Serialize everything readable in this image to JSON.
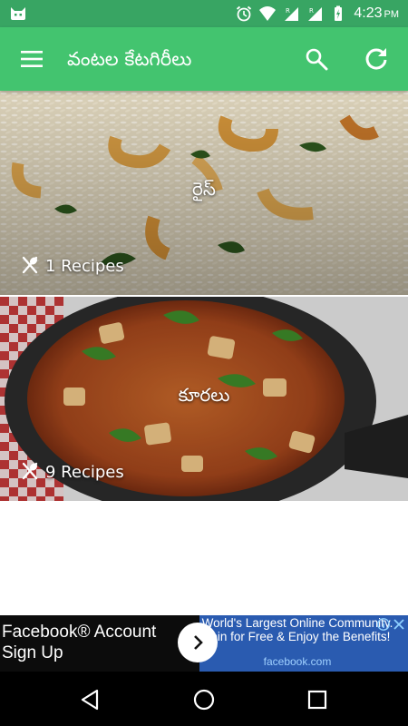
{
  "status_bar": {
    "time": "4:23",
    "ampm": "PM",
    "icons": [
      "android-cat-icon",
      "alarm-icon",
      "wifi-icon",
      "signal-r-icon",
      "signal-r-icon",
      "battery-charging-icon"
    ],
    "background": "#38a563"
  },
  "app_bar": {
    "title": "వంటల కేటగిరీలు",
    "background": "#43c46f",
    "icons": [
      "menu-icon",
      "search-icon",
      "refresh-icon"
    ]
  },
  "categories": [
    {
      "name": "రైస్",
      "count_text": "1 Recipes",
      "icon": "utensils-icon"
    },
    {
      "name": "కూరలు",
      "count_text": "9 Recipes",
      "icon": "utensils-icon"
    }
  ],
  "ad": {
    "headline": "Facebook® Account Sign Up",
    "promo_text": "World's Largest Online Community. Join for Free & Enjoy the Benefits!",
    "domain": "facebook.com",
    "icons": [
      "chevron-right-icon",
      "adchoices-info-icon",
      "close-icon"
    ]
  },
  "nav_bar": {
    "icons": [
      "back-icon",
      "home-icon",
      "recents-icon"
    ]
  }
}
